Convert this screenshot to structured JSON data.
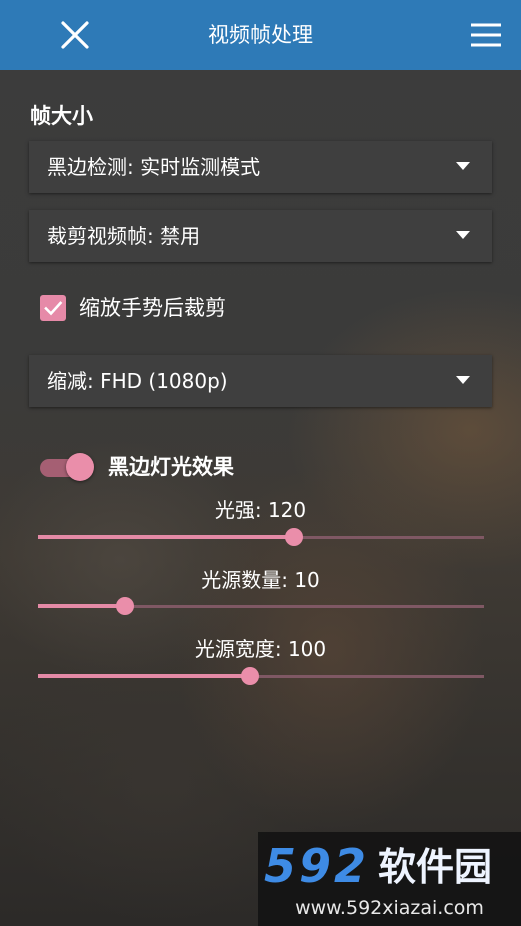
{
  "header": {
    "title": "视频帧处理",
    "close_icon": "close-icon",
    "menu_icon": "menu-icon",
    "bar_color": "#2e7ab7"
  },
  "frame_size": {
    "section_title": "帧大小",
    "black_border_detection": "黑边检测: 实时监测模式",
    "crop_frame": "裁剪视频帧: 禁用",
    "crop_after_zoom": {
      "label": "缩放手势后裁剪",
      "checked": true
    },
    "downscale": "缩减: FHD (1080p)"
  },
  "ambient_light": {
    "toggle_label": "黑边灯光效果",
    "enabled": true,
    "sliders": [
      {
        "label": "光强: 120",
        "fraction": 0.575
      },
      {
        "label": "光源数量: 10",
        "fraction": 0.195
      },
      {
        "label": "光源宽度: 100",
        "fraction": 0.475
      }
    ]
  },
  "accent_color": "#e68aa8",
  "watermark": {
    "number": "592",
    "name": "软件园",
    "url": "www.592xiazai.com"
  }
}
